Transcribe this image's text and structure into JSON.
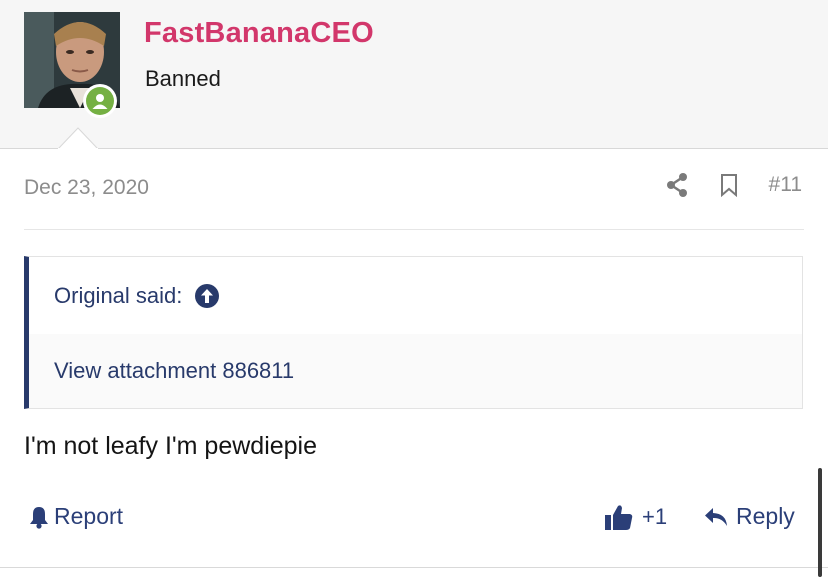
{
  "post": {
    "username": "FastBananaCEO",
    "user_title": "Banned",
    "date": "Dec 23, 2020",
    "post_number": "#11",
    "quote": {
      "author_label": "Original said:",
      "body": "View attachment 886811"
    },
    "message": "I'm not leafy I'm pewdiepie",
    "actions": {
      "report_label": "Report",
      "like_label": "+1",
      "reply_label": "Reply"
    }
  },
  "icons": {
    "avatar": "user-avatar-photo",
    "online": "online-status-icon",
    "share": "share-icon",
    "bookmark": "bookmark-icon",
    "quote_jump": "arrow-up-circle-icon",
    "report": "bell-icon",
    "like": "thumbs-up-icon",
    "reply": "reply-arrow-icon"
  },
  "colors": {
    "username": "#d2376b",
    "link": "#2b3f78",
    "quote_accent": "#283a6b",
    "online": "#75b043",
    "muted": "#8c8c8c"
  }
}
